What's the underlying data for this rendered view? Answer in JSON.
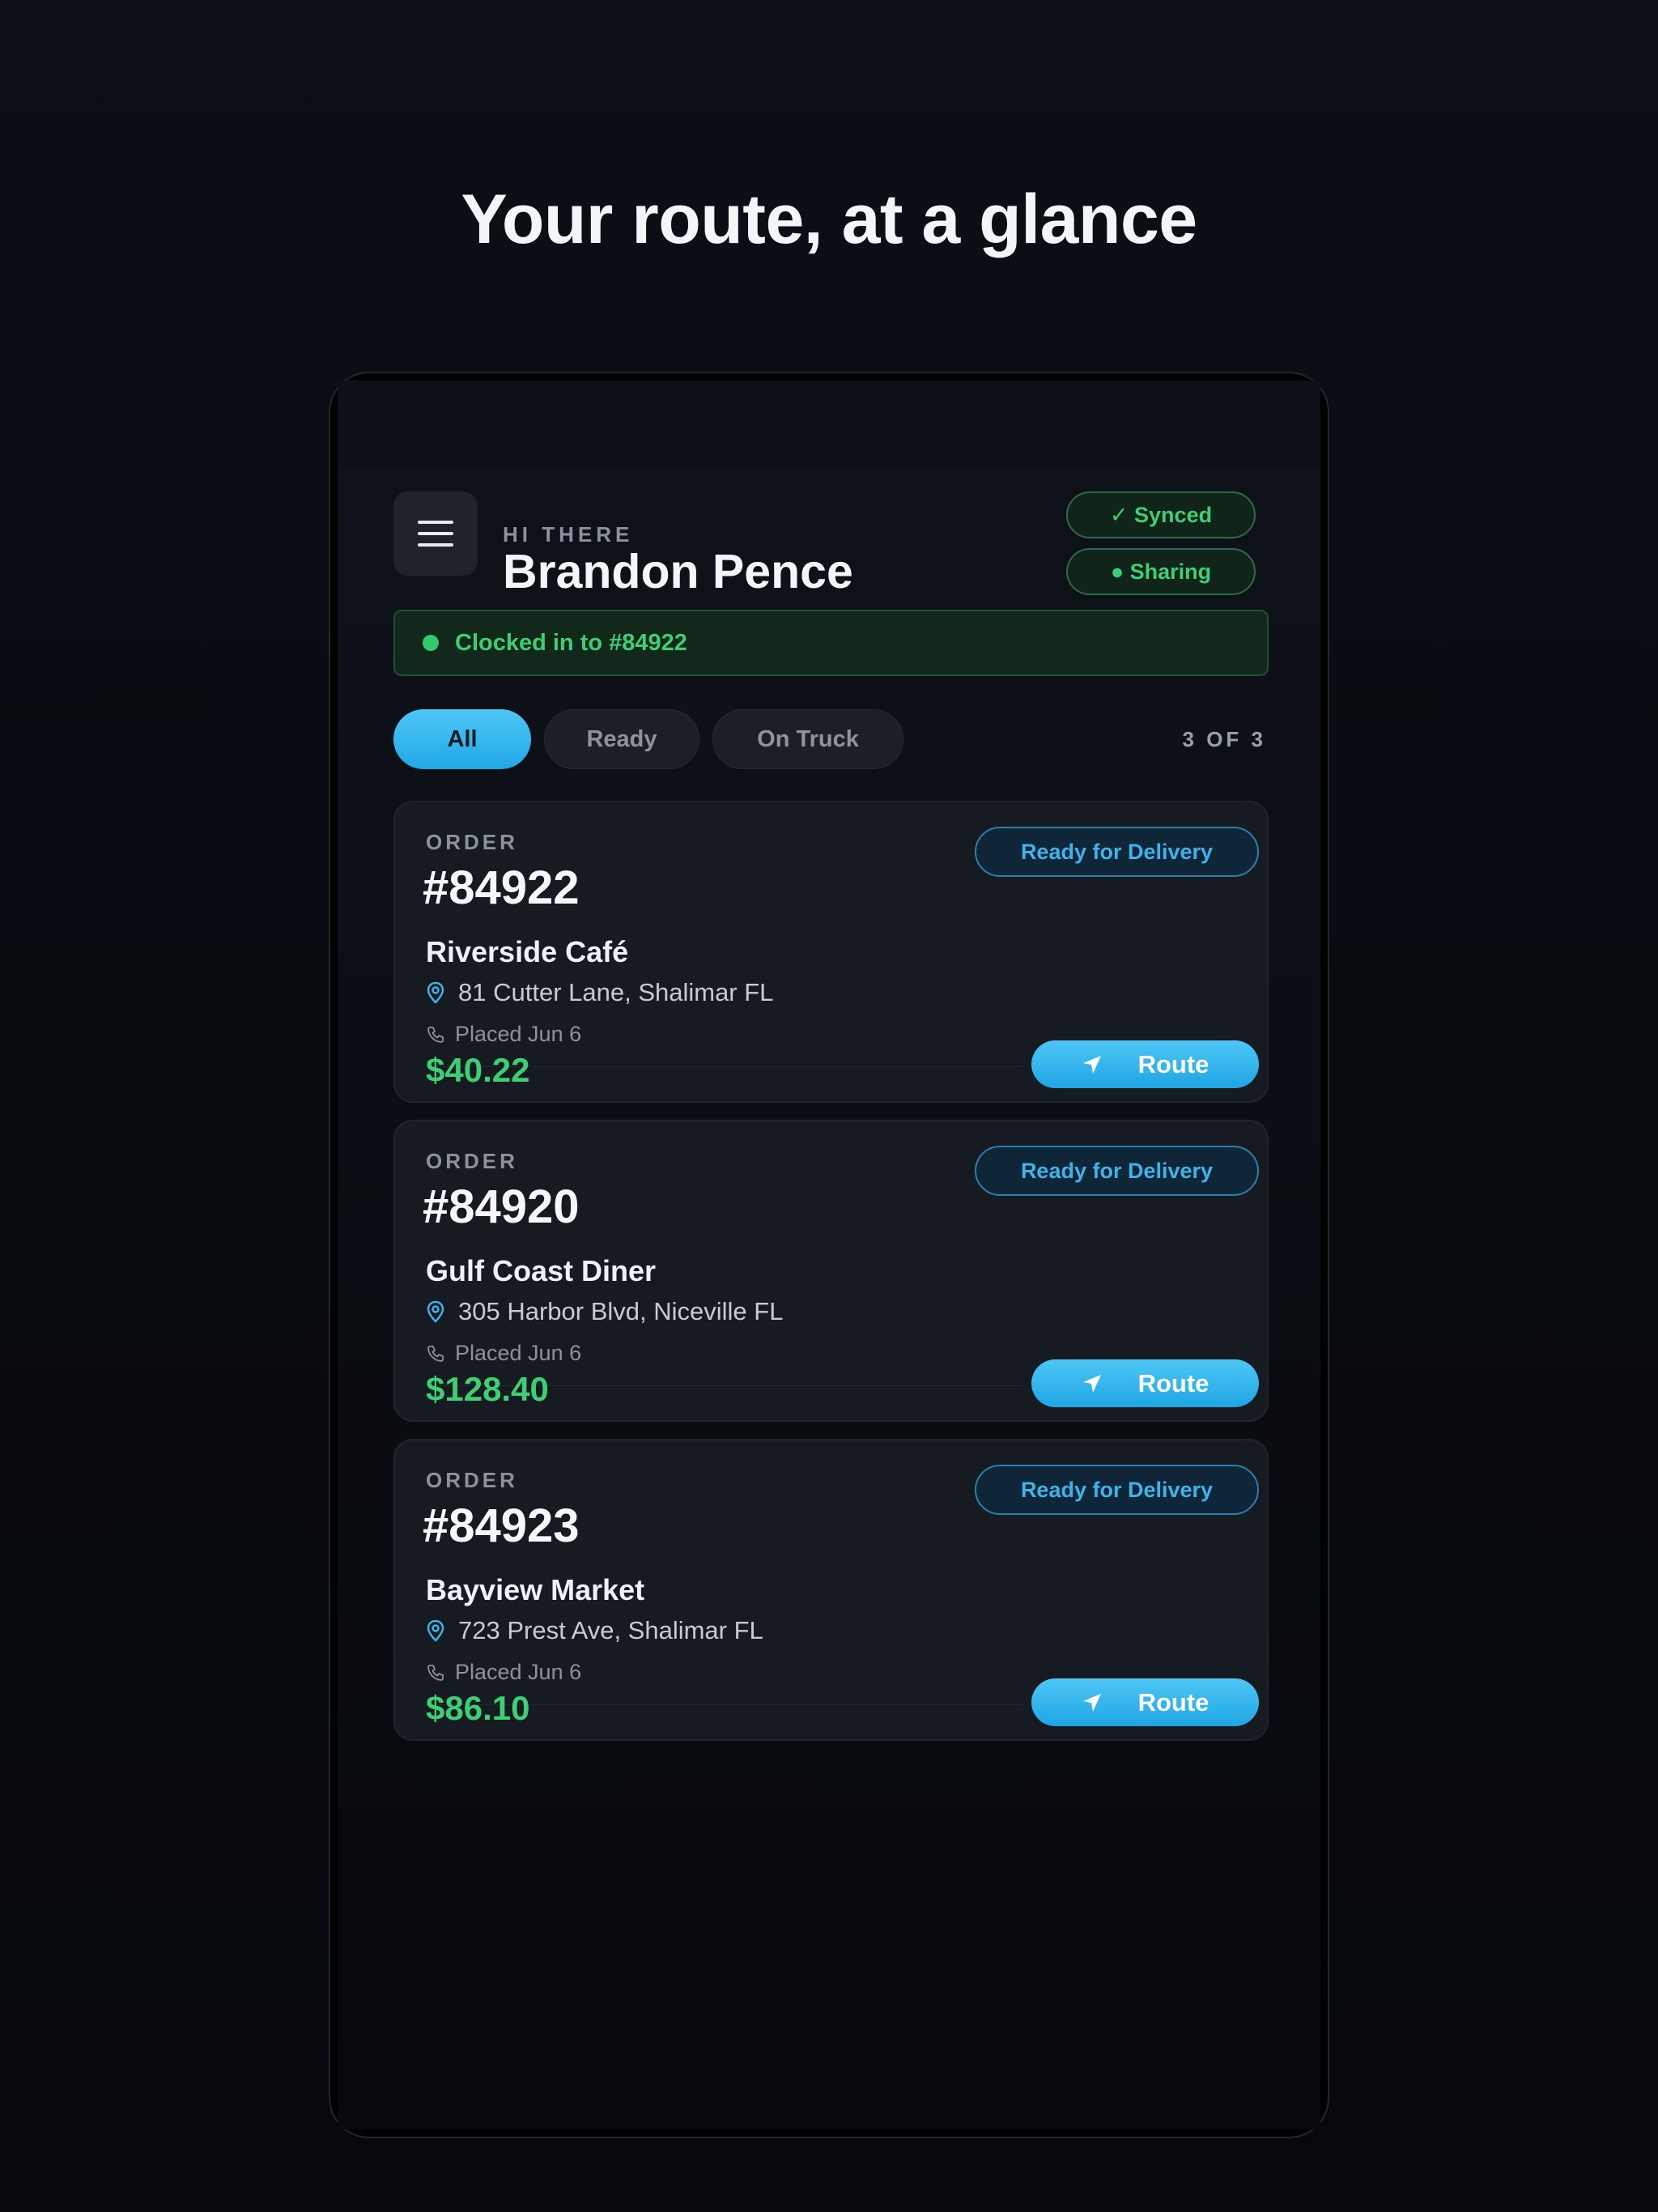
{
  "headline": "Your route, at a glance",
  "header": {
    "greeting": "HI THERE",
    "user_name": "Brandon Pence",
    "sync_pill": "✓ Synced",
    "sharing_pill": "● Sharing"
  },
  "clock_banner": {
    "text": "Clocked in to #84922"
  },
  "filters": {
    "tabs": [
      {
        "label": "All",
        "active": true
      },
      {
        "label": "Ready",
        "active": false
      },
      {
        "label": "On Truck",
        "active": false
      }
    ],
    "count": "3 OF 3"
  },
  "orders": [
    {
      "label": "ORDER",
      "number": "#84922",
      "status": "Ready for Delivery",
      "customer": "Riverside Café",
      "address": "81 Cutter Lane, Shalimar FL",
      "placed": "Placed Jun 6",
      "total": "$40.22",
      "action": "Route"
    },
    {
      "label": "ORDER",
      "number": "#84920",
      "status": "Ready for Delivery",
      "customer": "Gulf Coast Diner",
      "address": "305 Harbor Blvd, Niceville FL",
      "placed": "Placed Jun 6",
      "total": "$128.40",
      "action": "Route"
    },
    {
      "label": "ORDER",
      "number": "#84923",
      "status": "Ready for Delivery",
      "customer": "Bayview Market",
      "address": "723 Prest Ave, Shalimar FL",
      "placed": "Placed Jun 6",
      "total": "$86.10",
      "action": "Route"
    }
  ],
  "colors": {
    "accent": "#29aee8",
    "success": "#3ccf74",
    "background": "#0b0f16",
    "card": "#161a21"
  },
  "icons": {
    "menu": "hamburger-menu-icon",
    "location": "map-pin-icon",
    "phone": "phone-icon",
    "navigate": "navigation-arrow-icon"
  }
}
